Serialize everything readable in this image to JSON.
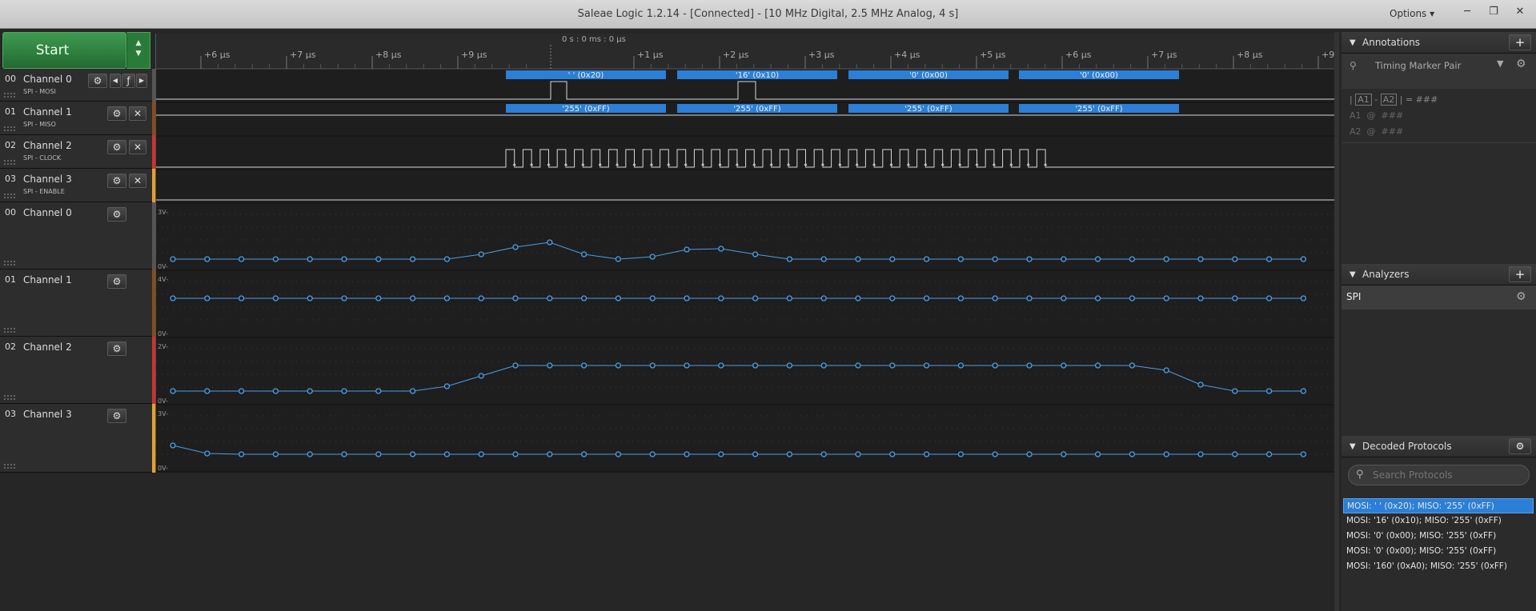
{
  "window": {
    "title": "Saleae Logic 1.2.14 - [Connected] - [10 MHz Digital, 2.5 MHz Analog, 4 s]",
    "options_label": "Options ▾",
    "minimize": "─",
    "restore": "❐",
    "close": "✕"
  },
  "start": {
    "label": "Start",
    "arrow_up": "▲",
    "arrow_down": "▼"
  },
  "timeline": {
    "center_label": "0 s : 0 ms : 0 μs",
    "ticks": [
      "+6 μs",
      "+7 μs",
      "+8 μs",
      "+9 μs",
      "+1 μs",
      "+2 μs",
      "+3 μs",
      "+4 μs",
      "+5 μs",
      "+6 μs",
      "+7 μs",
      "+8 μs",
      "+9"
    ]
  },
  "digital_channels": [
    {
      "num": "00",
      "name": "Channel 0",
      "signal": "SPI - MOSI",
      "color": "#555555"
    },
    {
      "num": "01",
      "name": "Channel 1",
      "signal": "SPI - MISO",
      "color": "#8b4a1e"
    },
    {
      "num": "02",
      "name": "Channel 2",
      "signal": "SPI - CLOCK",
      "color": "#d32f2f"
    },
    {
      "num": "03",
      "name": "Channel 3",
      "signal": "SPI - ENABLE",
      "color": "#e6a02a"
    }
  ],
  "analog_channels": [
    {
      "num": "00",
      "name": "Channel 0",
      "vmax": "3V-",
      "vmin": "0V-",
      "color": "#555555"
    },
    {
      "num": "01",
      "name": "Channel 1",
      "vmax": "4V-",
      "vmin": "0V-",
      "color": "#8b4a1e"
    },
    {
      "num": "02",
      "name": "Channel 2",
      "vmax": "2V-",
      "vmin": "0V-",
      "color": "#d32f2f"
    },
    {
      "num": "03",
      "name": "Channel 3",
      "vmax": "3V-",
      "vmin": "0V-",
      "color": "#e6a02a"
    }
  ],
  "icons": {
    "gear": "⚙",
    "close": "✕",
    "prev": "◀",
    "edge": "ƒ",
    "next": "▶"
  },
  "decoded_bubbles": {
    "mosi": [
      "' ' (0x20)",
      "'16' (0x10)",
      "'0' (0x00)",
      "'0' (0x00)"
    ],
    "miso": [
      "'255' (0xFF)",
      "'255' (0xFF)",
      "'255' (0xFF)",
      "'255' (0xFF)"
    ]
  },
  "annotations": {
    "header": "Annotations",
    "marker_pair": "Timing Marker Pair",
    "formula": {
      "pipe": "|",
      "a1": "A1",
      "dash": "-",
      "a2": "A2",
      "rest": "| = ###"
    },
    "a1_row": "A1  @  ###",
    "a2_row": "A2  @  ###"
  },
  "analyzers": {
    "header": "Analyzers",
    "items": [
      "SPI"
    ]
  },
  "decoded_protocols": {
    "header": "Decoded Protocols",
    "search_placeholder": "Search Protocols",
    "items": [
      "MOSI: ' ' (0x20);  MISO: '255' (0xFF)",
      "MOSI: '16' (0x10);  MISO: '255' (0xFF)",
      "MOSI: '0' (0x00);  MISO: '255' (0xFF)",
      "MOSI: '0' (0x00);  MISO: '255' (0xFF)",
      "MOSI: '160' (0xA0);  MISO: '255' (0xFF)"
    ],
    "selected_index": 0
  },
  "colors": {
    "accent": "#2c7fd6",
    "start_green": "#2e8a3e",
    "waveform": "#e0e0e0",
    "analog": "#4a9fe8"
  }
}
